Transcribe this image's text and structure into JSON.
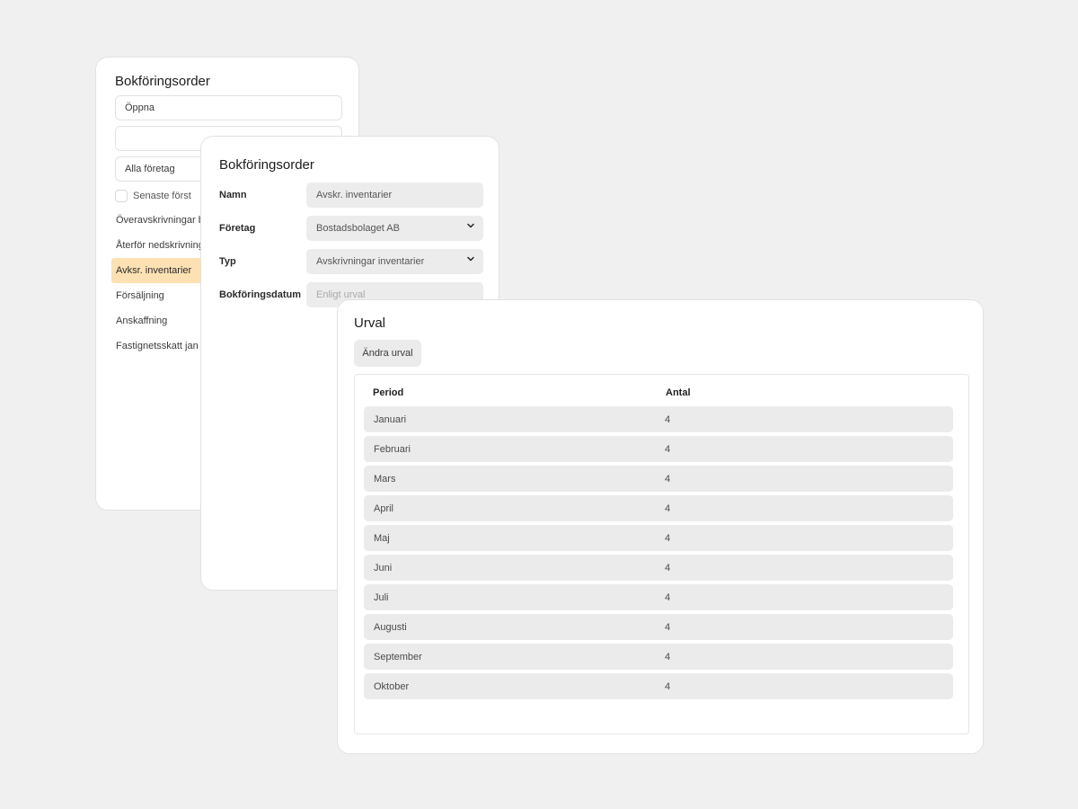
{
  "panel_list": {
    "title": "Bokföringsorder",
    "search_value": "Öppna",
    "blank_value": "",
    "company_filter": "Alla företag",
    "checkbox_label": "Senaste först",
    "items": [
      {
        "label": "Överavskrivningar bostad",
        "active": false
      },
      {
        "label": "Återför nedskrivning",
        "active": false
      },
      {
        "label": "Avksr. inventarier",
        "active": true
      },
      {
        "label": "Försäljning",
        "active": false
      },
      {
        "label": "Anskaffning",
        "active": false
      },
      {
        "label": "Fastignetsskatt jan",
        "active": false
      }
    ]
  },
  "panel_form": {
    "title": "Bokföringsorder",
    "fields": {
      "namn": {
        "label": "Namn",
        "value": "Avskr. inventarier"
      },
      "foretag": {
        "label": "Företag",
        "value": "Bostadsbolaget AB"
      },
      "typ": {
        "label": "Typ",
        "value": "Avskrivningar inventarier"
      },
      "datum": {
        "label": "Bokföringsdatum",
        "placeholder": "Enligt urval"
      }
    }
  },
  "panel_urval": {
    "title": "Urval",
    "change_button": "Ändra urval",
    "columns": {
      "period": "Period",
      "antal": "Antal"
    },
    "rows": [
      {
        "period": "Januari",
        "antal": "4"
      },
      {
        "period": "Februari",
        "antal": "4"
      },
      {
        "period": "Mars",
        "antal": "4"
      },
      {
        "period": "April",
        "antal": "4"
      },
      {
        "period": "Maj",
        "antal": "4"
      },
      {
        "period": "Juni",
        "antal": "4"
      },
      {
        "period": "Juli",
        "antal": "4"
      },
      {
        "period": "Augusti",
        "antal": "4"
      },
      {
        "period": "September",
        "antal": "4"
      },
      {
        "period": "Oktober",
        "antal": "4"
      }
    ]
  },
  "colors": {
    "background": "#f0f0f0",
    "active_item": "#fde1b2",
    "input_fill": "#ececec"
  }
}
